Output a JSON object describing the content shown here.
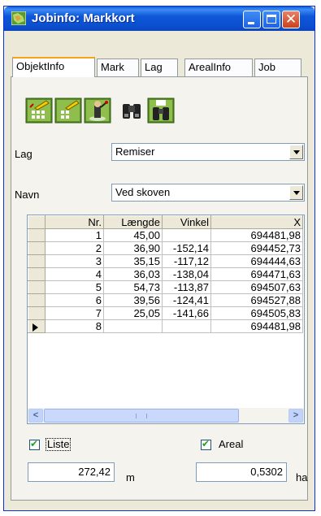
{
  "window": {
    "title": "Jobinfo: Markkort"
  },
  "tabs": [
    {
      "label": "ObjektInfo"
    },
    {
      "label": "Mark"
    },
    {
      "label": "Lag"
    },
    {
      "label": "ArealInfo"
    },
    {
      "label": "Job"
    }
  ],
  "toolbar": {
    "icons": [
      "edit-points-icon",
      "edit-lines-icon",
      "surveyor-icon",
      "binoculars-icon",
      "binoculars-numbered-icon"
    ]
  },
  "form": {
    "lag_label": "Lag",
    "lag_value": "Remiser",
    "navn_label": "Navn",
    "navn_value": "Ved skoven"
  },
  "table": {
    "columns": [
      "Nr.",
      "Længde",
      "Vinkel",
      "X"
    ],
    "rows": [
      {
        "nr": "1",
        "laengde": "45,00",
        "vinkel": "",
        "x": "694481,98"
      },
      {
        "nr": "2",
        "laengde": "36,90",
        "vinkel": "-152,14",
        "x": "694452,73"
      },
      {
        "nr": "3",
        "laengde": "35,15",
        "vinkel": "-117,12",
        "x": "694444,63"
      },
      {
        "nr": "4",
        "laengde": "36,03",
        "vinkel": "-138,04",
        "x": "694471,63"
      },
      {
        "nr": "5",
        "laengde": "54,73",
        "vinkel": "-113,87",
        "x": "694507,63"
      },
      {
        "nr": "6",
        "laengde": "39,56",
        "vinkel": "-124,41",
        "x": "694527,88"
      },
      {
        "nr": "7",
        "laengde": "25,05",
        "vinkel": "-141,66",
        "x": "694505,83"
      },
      {
        "nr": "8",
        "laengde": "",
        "vinkel": "",
        "x": "694481,98"
      }
    ]
  },
  "footer": {
    "liste_label": "Liste",
    "liste_checked": true,
    "areal_label": "Areal",
    "areal_checked": true,
    "length_value": "272,42",
    "length_unit": "m",
    "area_value": "0,5302",
    "area_unit": "ha"
  },
  "colors": {
    "titlebar": "#0b4fd0",
    "tab_active_highlight": "#f3a61c",
    "window_face": "#ece9d8"
  }
}
